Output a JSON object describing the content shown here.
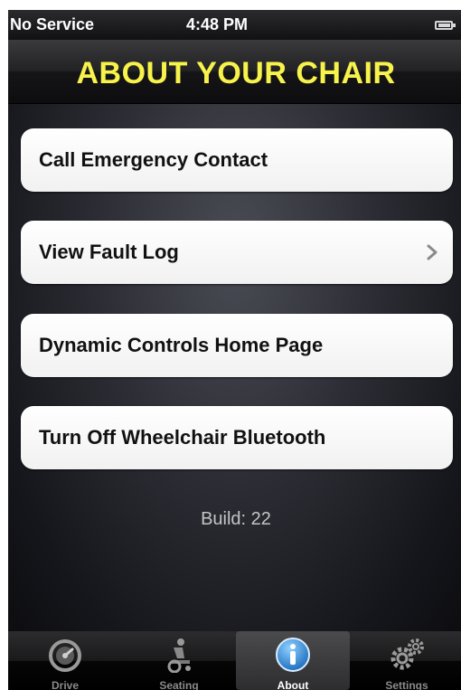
{
  "status_bar": {
    "carrier": "No Service",
    "time": "4:48 PM"
  },
  "header": {
    "title": "ABOUT YOUR CHAIR"
  },
  "menu": {
    "items": [
      {
        "label": "Call Emergency Contact",
        "has_chevron": false
      },
      {
        "label": "View Fault Log",
        "has_chevron": true
      },
      {
        "label": "Dynamic Controls Home Page",
        "has_chevron": false
      },
      {
        "label": "Turn Off Wheelchair Bluetooth",
        "has_chevron": false
      }
    ]
  },
  "build": "Build: 22",
  "tab_bar": {
    "tabs": [
      {
        "label": "Drive",
        "icon": "speedometer-icon",
        "active": false
      },
      {
        "label": "Seating",
        "icon": "wheelchair-icon",
        "active": false
      },
      {
        "label": "About",
        "icon": "info-icon",
        "active": true
      },
      {
        "label": "Settings",
        "icon": "gears-icon",
        "active": false
      }
    ]
  },
  "colors": {
    "title": "#f7f34b",
    "background": "#0c0c0e",
    "button": "#ffffff",
    "active_tab_icon": "#2f8fd8"
  }
}
